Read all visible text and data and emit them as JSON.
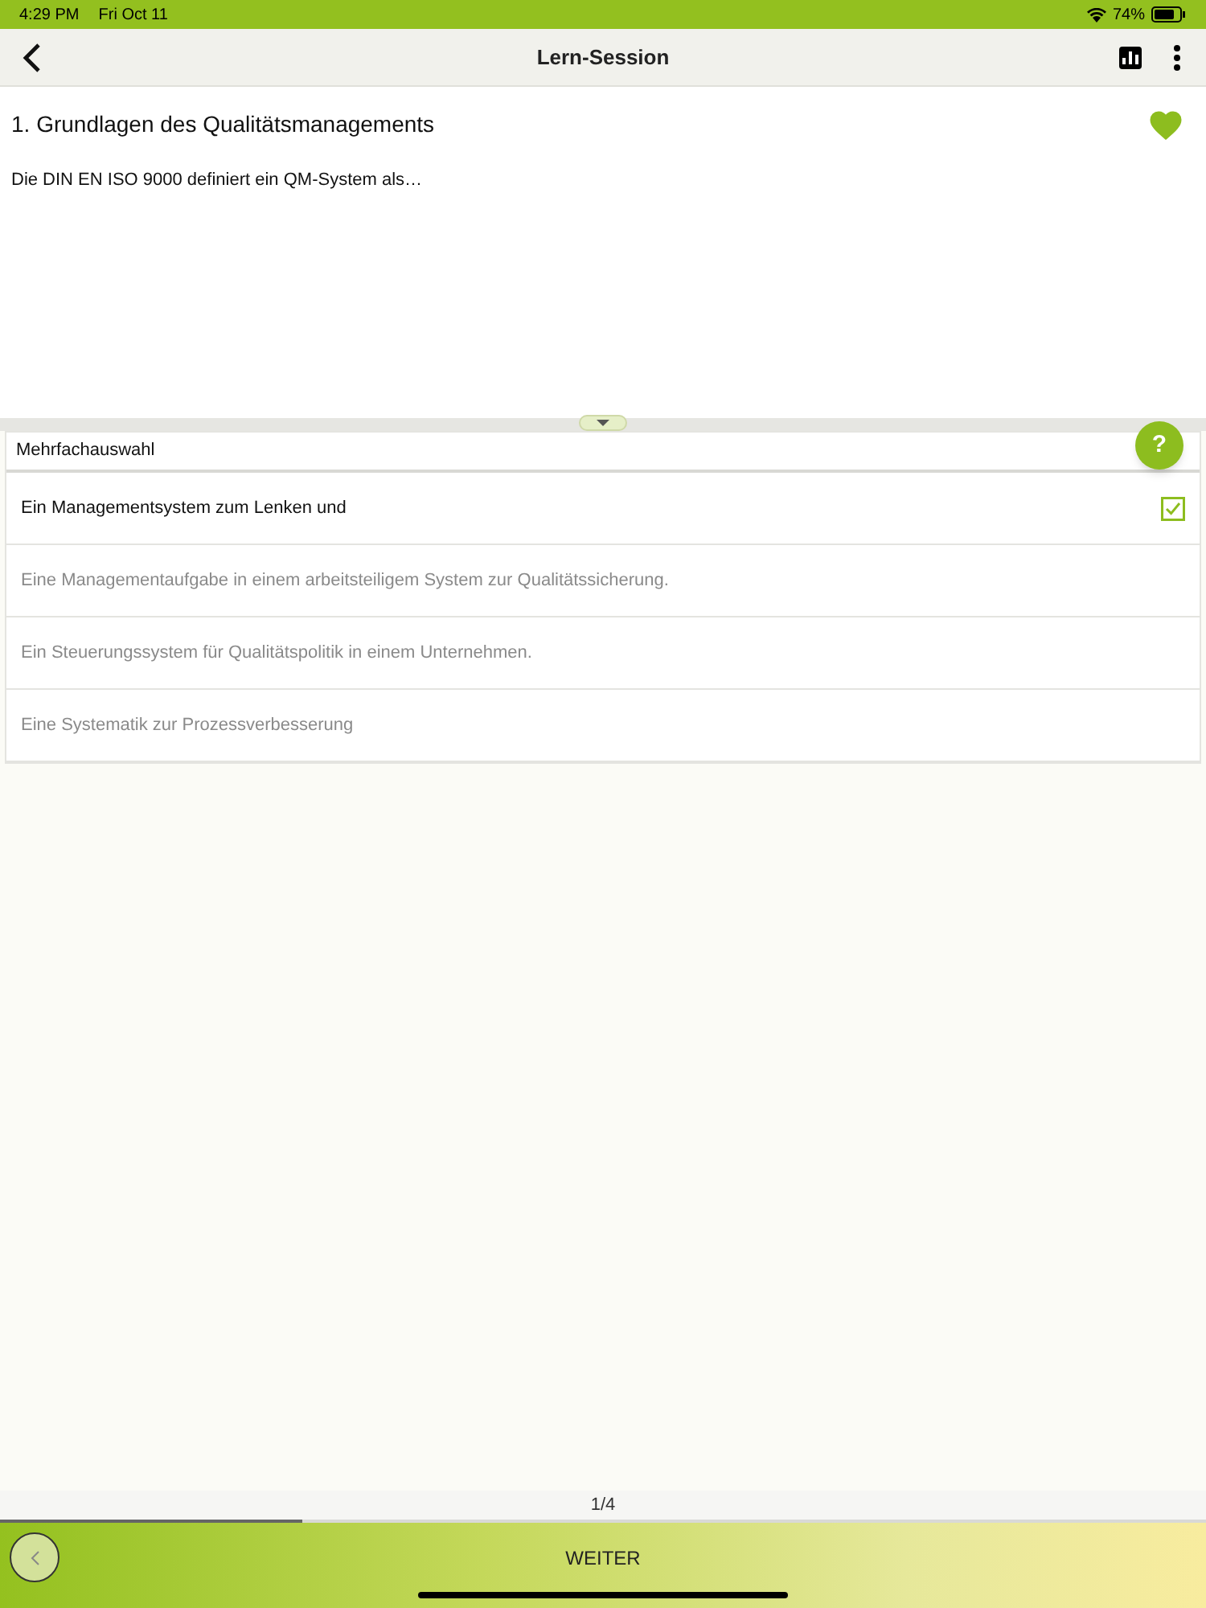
{
  "status_bar": {
    "time": "4:29 PM",
    "date": "Fri Oct 11",
    "battery": "74%"
  },
  "nav": {
    "title": "Lern-Session"
  },
  "question": {
    "title": "1. Grundlagen des Qualitätsmanagements",
    "favorite": true,
    "text": "Die DIN EN ISO 9000 definiert ein QM-System als…"
  },
  "answers": {
    "type": "Mehrfachauswahl",
    "help": "?",
    "options": [
      {
        "text": "Ein Managementsystem zum Lenken und",
        "checked": true
      },
      {
        "text": "Eine Managementaufgabe in einem arbeitsteiligem System zur Qualitätssicherung.",
        "checked": false
      },
      {
        "text": "Ein Steuerungssystem für Qualitätspolitik in einem Unternehmen.",
        "checked": false
      },
      {
        "text": "Eine Systematik zur Prozessverbesserung",
        "checked": false
      }
    ]
  },
  "progress": {
    "label": "1/4",
    "level": 0.25
  },
  "footer": {
    "next": "WEITER"
  }
}
